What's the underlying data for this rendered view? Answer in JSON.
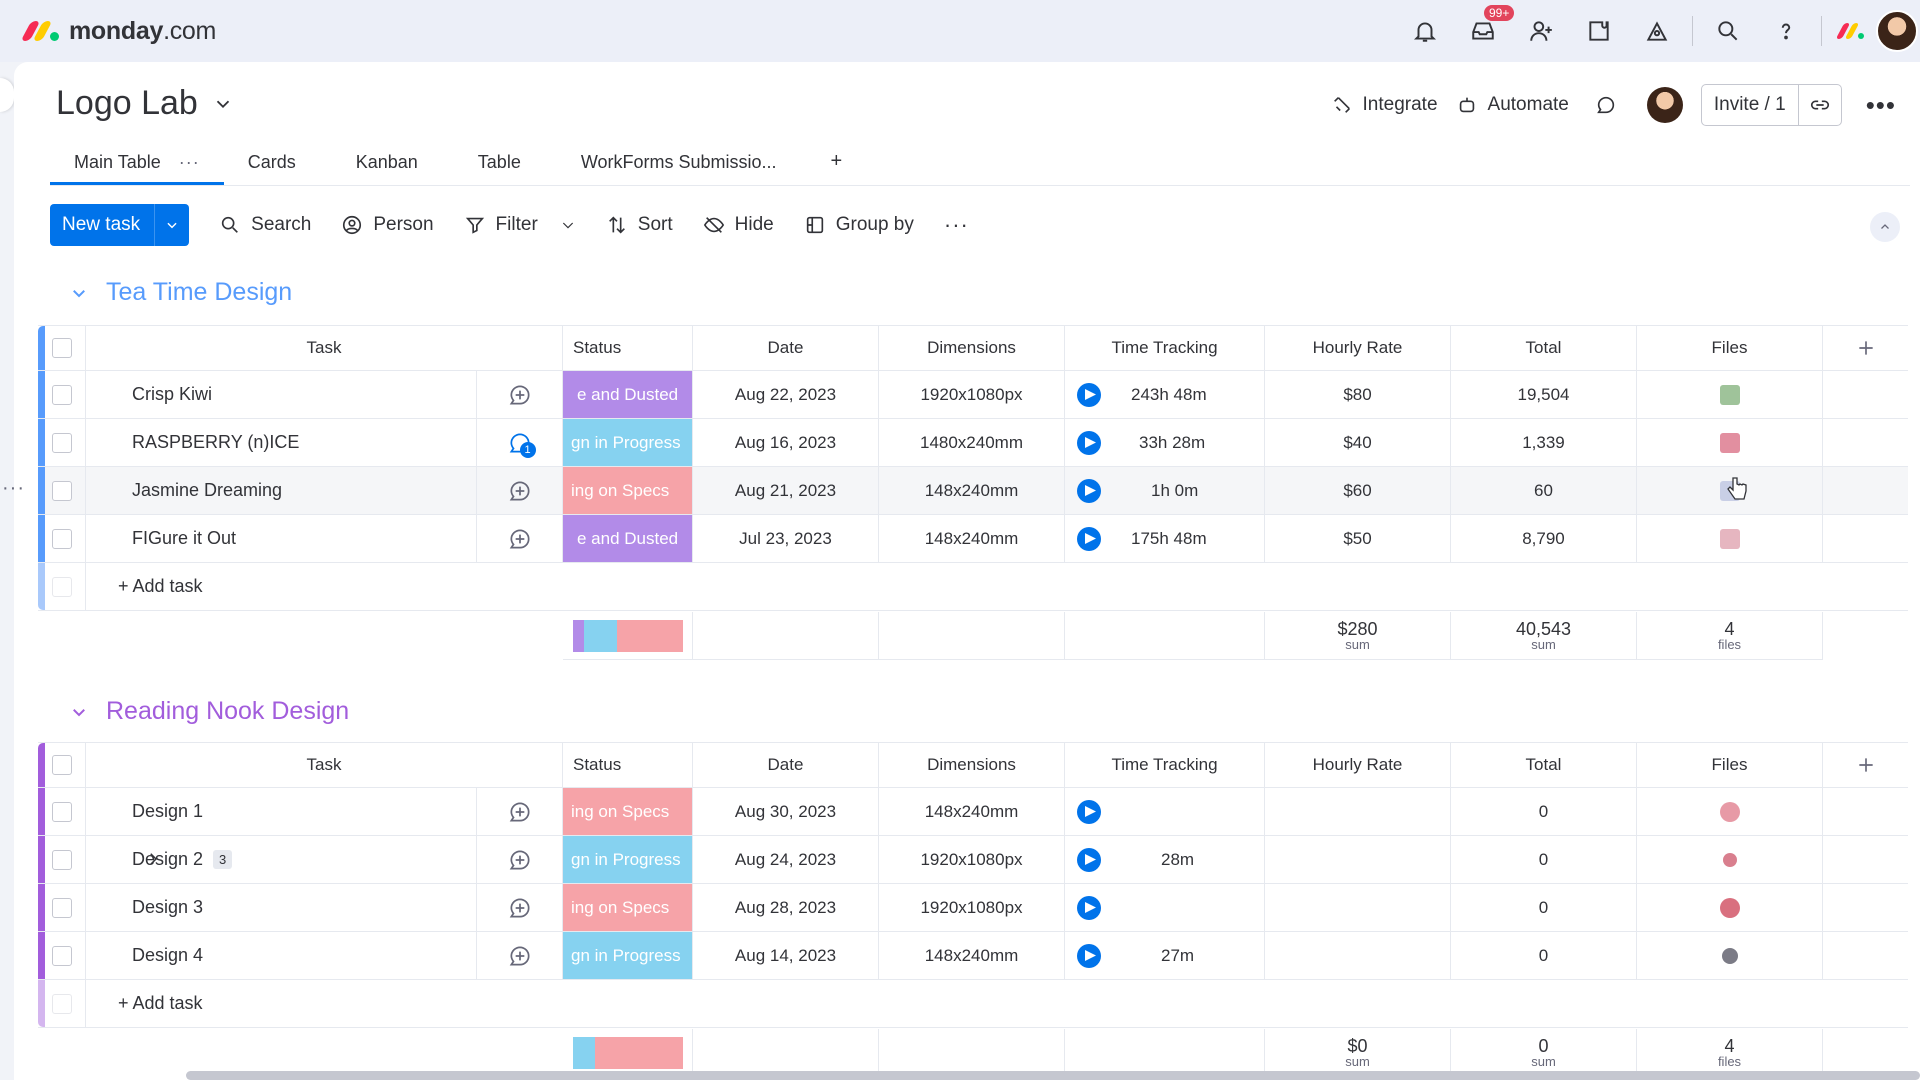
{
  "app": {
    "logo_bold": "monday",
    "logo_light": ".com",
    "logo_colors": [
      "#f62b54",
      "#ffcc00",
      "#00ca72"
    ],
    "notification_badge": "99+"
  },
  "board": {
    "title": "Logo Lab",
    "integrate_label": "Integrate",
    "automate_label": "Automate",
    "invite_label": "Invite / 1"
  },
  "tabs": [
    {
      "label": "Main Table",
      "active": true
    },
    {
      "label": "Cards"
    },
    {
      "label": "Kanban"
    },
    {
      "label": "Table"
    },
    {
      "label": "WorkForms Submissio..."
    }
  ],
  "toolbar": {
    "new_task": "New task",
    "search": "Search",
    "person": "Person",
    "filter": "Filter",
    "sort": "Sort",
    "hide": "Hide",
    "group_by": "Group by"
  },
  "columns": {
    "task": "Task",
    "status": "Status",
    "date": "Date",
    "dimensions": "Dimensions",
    "time": "Time Tracking",
    "rate": "Hourly Rate",
    "total": "Total",
    "files": "Files"
  },
  "colors": {
    "accent": "#0073ea",
    "purple_status": "#a25ddc",
    "lavender": "#c4a4f5",
    "sky": "#7fd4f3",
    "coral": "#f5999f"
  },
  "groups": [
    {
      "title": "Tea Time Design",
      "color": "#579bfc",
      "rows": [
        {
          "task": "Crisp Kiwi",
          "status": "e and Dusted",
          "status_color": "#b28be8",
          "date": "Aug 22, 2023",
          "dim": "1920x1080px",
          "time": "243h 48m",
          "rate": "$80",
          "total": "19,504",
          "thumb": "#9fc39a"
        },
        {
          "task": "RASPBERRY (n)ICE",
          "status": "gn in Progress",
          "status_color": "#86d2f0",
          "date": "Aug 16, 2023",
          "dim": "1480x240mm",
          "time": "33h 28m",
          "rate": "$40",
          "total": "1,339",
          "thumb": "#e28fa0",
          "updates": "1"
        },
        {
          "task": "Jasmine Dreaming",
          "status": "ing on Specs",
          "status_color": "#f6a3a8",
          "date": "Aug 21, 2023",
          "dim": "148x240mm",
          "time": "1h 0m",
          "rate": "$60",
          "total": "60",
          "thumb": "#c9cfe6"
        },
        {
          "task": "FIGure it Out",
          "status": "e and Dusted",
          "status_color": "#b28be8",
          "date": "Jul 23, 2023",
          "dim": "148x240mm",
          "time": "175h 48m",
          "rate": "$50",
          "total": "8,790",
          "thumb": "#e6b6c0"
        }
      ],
      "add_task": "+ Add task",
      "summary": {
        "rate": "$280",
        "rate_label": "sum",
        "total": "40,543",
        "total_label": "sum",
        "files": "4",
        "files_label": "files"
      },
      "status_breakdown": [
        0.1,
        0.3,
        0.6
      ]
    },
    {
      "title": "Reading Nook Design",
      "color": "#a25ddc",
      "rows": [
        {
          "task": "Design 1",
          "status": "ing on Specs",
          "status_color": "#f6a3a8",
          "date": "Aug 30, 2023",
          "dim": "148x240mm",
          "time": "",
          "rate": "",
          "total": "0",
          "thumb": "#e79aa6"
        },
        {
          "task": "Design 2",
          "subitems": "3",
          "status": "gn in Progress",
          "status_color": "#86d2f0",
          "date": "Aug 24, 2023",
          "dim": "1920x1080px",
          "time": "28m",
          "rate": "",
          "total": "0",
          "thumb": "#d97f8e"
        },
        {
          "task": "Design 3",
          "status": "ing on Specs",
          "status_color": "#f6a3a8",
          "date": "Aug 28, 2023",
          "dim": "1920x1080px",
          "time": "",
          "rate": "",
          "total": "0",
          "thumb": "#d9707f"
        },
        {
          "task": "Design 4",
          "status": "gn in Progress",
          "status_color": "#86d2f0",
          "date": "Aug 14, 2023",
          "dim": "148x240mm",
          "time": "27m",
          "rate": "",
          "total": "0",
          "thumb": "#7b7b86"
        }
      ],
      "add_task": "+ Add task",
      "summary": {
        "rate": "$0",
        "rate_label": "sum",
        "total": "0",
        "total_label": "sum",
        "files": "4",
        "files_label": "files"
      },
      "status_breakdown": [
        0.2,
        0.8
      ]
    }
  ]
}
